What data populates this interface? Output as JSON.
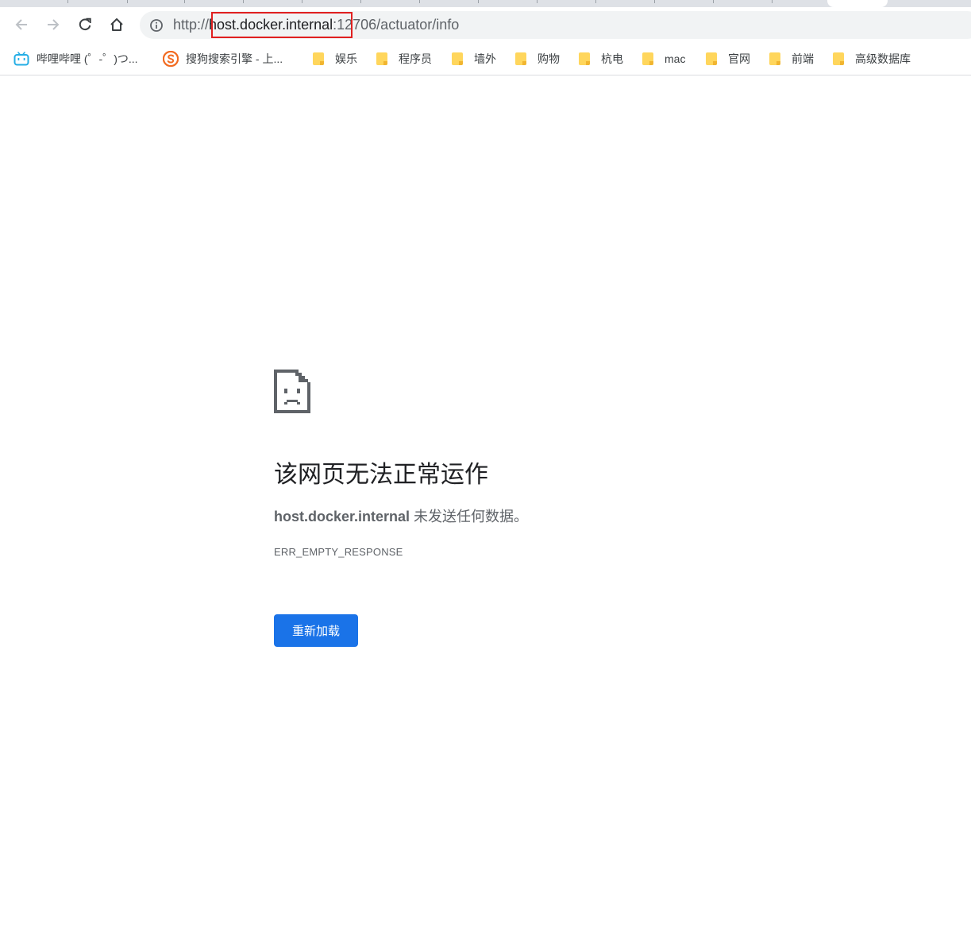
{
  "browser": {
    "url": {
      "scheme": "http://",
      "host": "host.docker.internal",
      "rest": ":12706/actuator/info"
    },
    "icons": {
      "back": "arrow-left-icon",
      "forward": "arrow-right-icon",
      "reload": "reload-icon",
      "home": "home-icon",
      "site_info": "info-icon"
    }
  },
  "bookmarks": [
    {
      "label": "哔哩哔哩 (゜-゜)つ...",
      "icon": "bilibili-icon"
    },
    {
      "label": "搜狗搜索引擎 - 上...",
      "icon": "sogou-icon"
    },
    {
      "label": "娱乐",
      "icon": "folder-icon"
    },
    {
      "label": "程序员",
      "icon": "folder-icon"
    },
    {
      "label": "墙外",
      "icon": "folder-icon"
    },
    {
      "label": "购物",
      "icon": "folder-icon"
    },
    {
      "label": "杭电",
      "icon": "folder-icon"
    },
    {
      "label": "mac",
      "icon": "folder-icon"
    },
    {
      "label": "官网",
      "icon": "folder-icon"
    },
    {
      "label": "前端",
      "icon": "folder-icon"
    },
    {
      "label": "高级数据库",
      "icon": "folder-icon"
    }
  ],
  "error": {
    "icon": "sad-page-icon",
    "title": "该网页无法正常运作",
    "host": "host.docker.internal",
    "message": " 未发送任何数据。",
    "code": "ERR_EMPTY_RESPONSE",
    "reload_label": "重新加载"
  },
  "colors": {
    "accent": "#1a73e8",
    "highlight": "#e02020",
    "folder": "#ffd65c"
  }
}
